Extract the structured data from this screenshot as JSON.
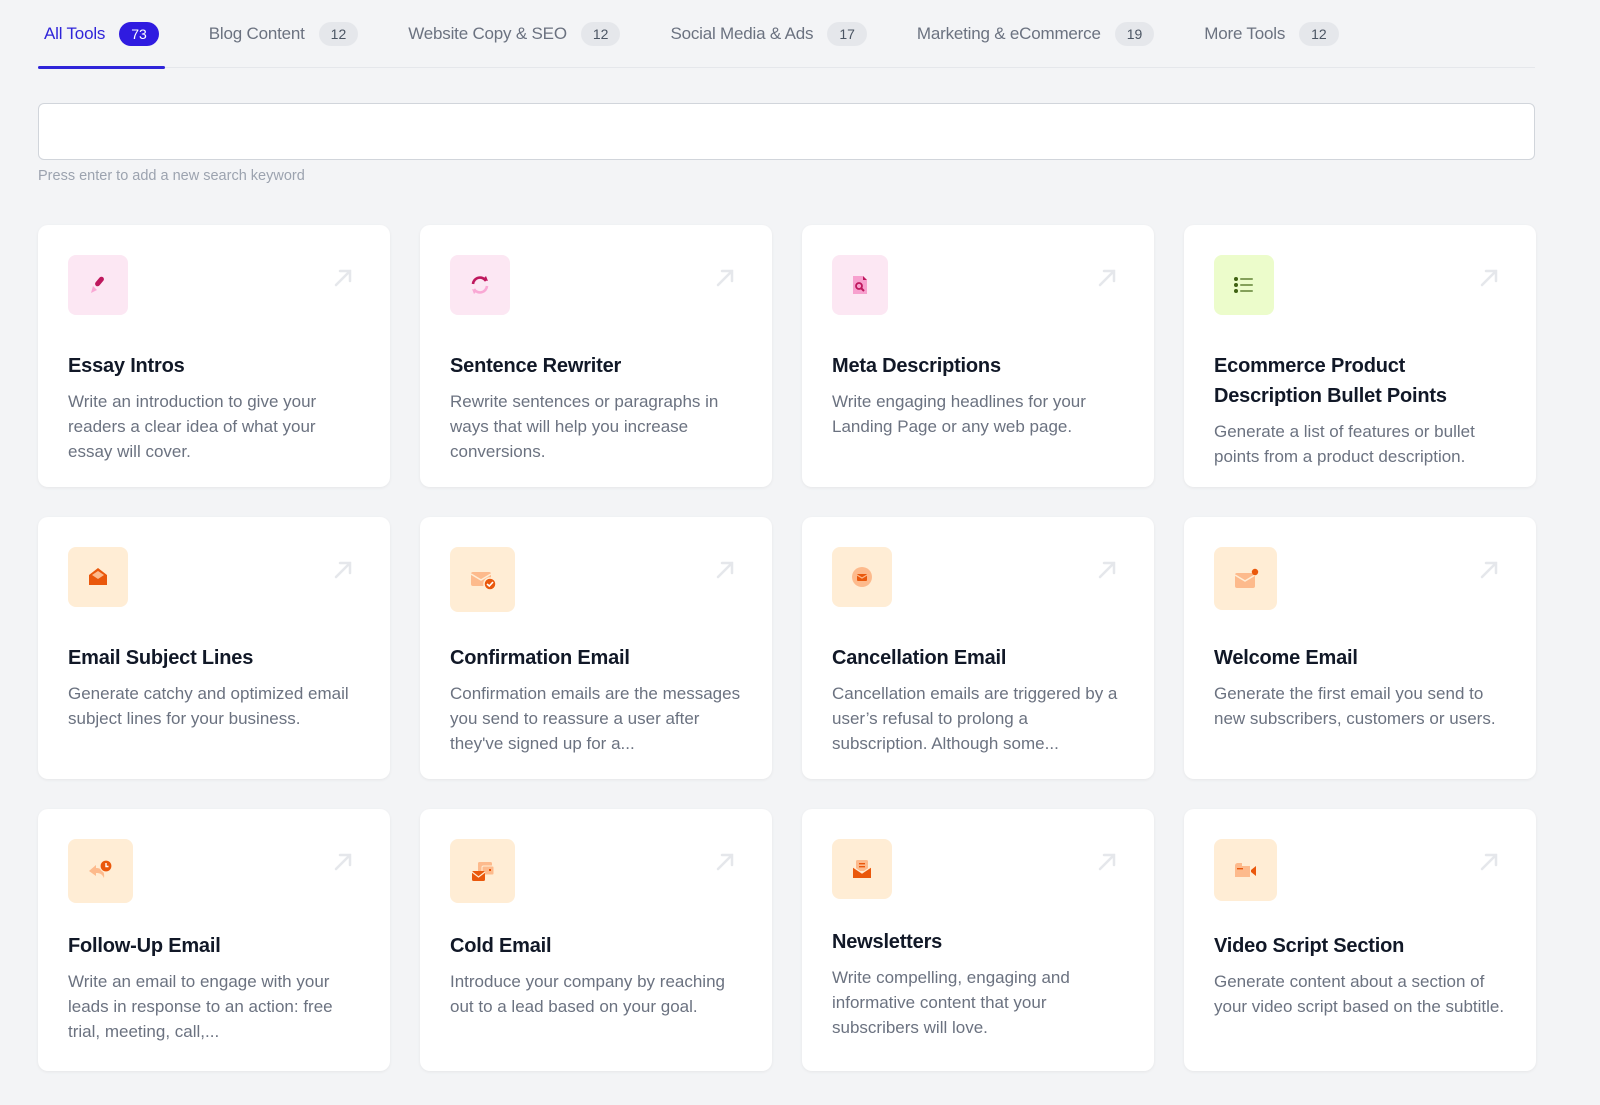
{
  "tabs": [
    {
      "label": "All Tools",
      "count": "73",
      "active": true
    },
    {
      "label": "Blog Content",
      "count": "12"
    },
    {
      "label": "Website Copy & SEO",
      "count": "12"
    },
    {
      "label": "Social Media & Ads",
      "count": "17"
    },
    {
      "label": "Marketing & eCommerce",
      "count": "19"
    },
    {
      "label": "More Tools",
      "count": "12"
    }
  ],
  "search": {
    "value": "",
    "placeholder": "",
    "hint": "Press enter to add a new search keyword"
  },
  "colors": {
    "accent": "#2f24d9",
    "pink_bg": "#fce7f3",
    "pink_icon": "#be185d",
    "green_bg": "#ecfccb",
    "green_icon": "#3f6212",
    "orange_bg": "#ffedd5",
    "orange_icon": "#ea580c"
  },
  "tools": [
    {
      "title": "Essay Intros",
      "description": "Write an introduction to give your readers a clear idea of what your essay will cover.",
      "icon": "pen-nib-icon"
    },
    {
      "title": "Sentence Rewriter",
      "description": "Rewrite sentences or paragraphs in ways that will help you increase conversions.",
      "icon": "refresh-icon"
    },
    {
      "title": "Meta Descriptions",
      "description": "Write engaging headlines for your Landing Page or any web page.",
      "icon": "file-search-icon"
    },
    {
      "title": "Ecommerce Product Description Bullet Points",
      "description": "Generate a list of features or bullet points from a product description.",
      "icon": "list-bullet-icon"
    },
    {
      "title": "Email Subject Lines",
      "description": "Generate catchy and optimized email subject lines for your business.",
      "icon": "envelope-open-icon"
    },
    {
      "title": "Confirmation Email",
      "description": "Confirmation emails are the messages you send to reassure a user after they've signed up for a...",
      "icon": "envelope-check-icon"
    },
    {
      "title": "Cancellation Email",
      "description": "Cancellation emails are triggered by a user’s refusal to prolong a subscription. Although some...",
      "icon": "envelope-circle-icon"
    },
    {
      "title": "Welcome Email",
      "description": "Generate the first email you send to new subscribers, customers or users.",
      "icon": "envelope-dot-icon"
    },
    {
      "title": "Follow-Up Email",
      "description": "Write an email to engage with your leads in response to an action: free trial, meeting, call,...",
      "icon": "reply-clock-icon"
    },
    {
      "title": "Cold Email",
      "description": "Introduce your company by reaching out to a lead based on your goal.",
      "icon": "envelope-stack-icon"
    },
    {
      "title": "Newsletters",
      "description": "Write compelling, engaging and informative content that your subscribers will love.",
      "icon": "newsletter-icon"
    },
    {
      "title": "Video Script Section",
      "description": "Generate content about a section of your video script based on the subtitle.",
      "icon": "video-camera-icon"
    }
  ]
}
